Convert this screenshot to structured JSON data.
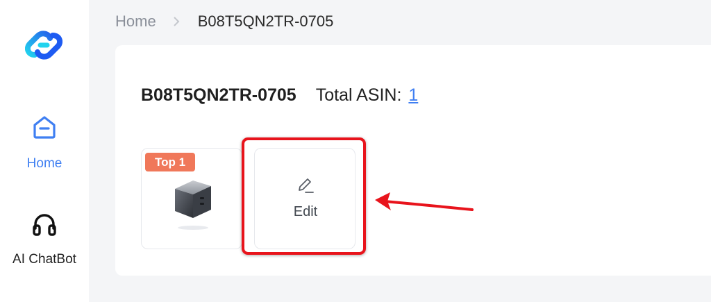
{
  "sidebar": {
    "items": [
      {
        "label": "Home",
        "icon": "home-icon",
        "active": true
      },
      {
        "label": "AI ChatBot",
        "icon": "headphones-icon",
        "active": false
      }
    ]
  },
  "breadcrumb": {
    "home": "Home",
    "current": "B08T5QN2TR-0705"
  },
  "card": {
    "title": "B08T5QN2TR-0705",
    "total_label": "Total ASIN:",
    "total_value": "1"
  },
  "product": {
    "badge": "Top 1"
  },
  "edit_tile": {
    "label": "Edit"
  },
  "colors": {
    "accent": "#3f7ff2",
    "badge": "#f0785a",
    "annotation": "#e8141c"
  }
}
